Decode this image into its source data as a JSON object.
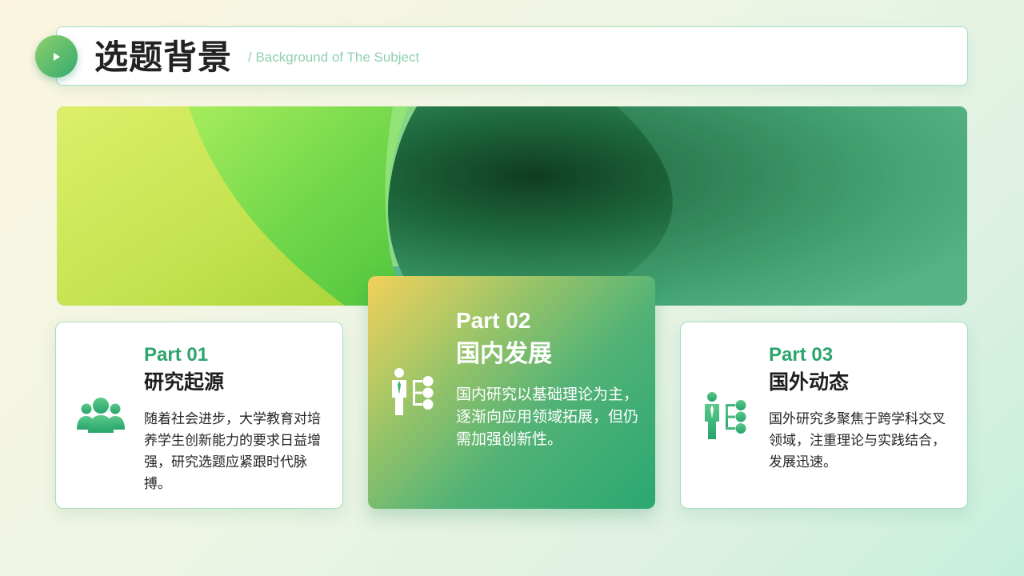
{
  "header": {
    "title": "选题背景",
    "subtitle": "/ Background of The Subject"
  },
  "colors": {
    "accent": "#2fa36e",
    "accent_light": "#8ed06a",
    "highlight_card_start": "#f2d05a",
    "highlight_card_end": "#2aa870"
  },
  "cards": [
    {
      "part": "Part 01",
      "title": "研究起源",
      "body": "随着社会进步，大学教育对培养学生创新能力的要求日益增强，研究选题应紧跟时代脉搏。",
      "icon": "people-group-icon"
    },
    {
      "part": "Part 02",
      "title": "国内发展",
      "body": "国内研究以基础理论为主，逐渐向应用领域拓展，但仍需加强创新性。",
      "icon": "person-network-icon"
    },
    {
      "part": "Part 03",
      "title": "国外动态",
      "body": "国外研究多聚焦于跨学科交叉领域，注重理论与实践结合，发展迅速。",
      "icon": "person-network-icon"
    }
  ]
}
